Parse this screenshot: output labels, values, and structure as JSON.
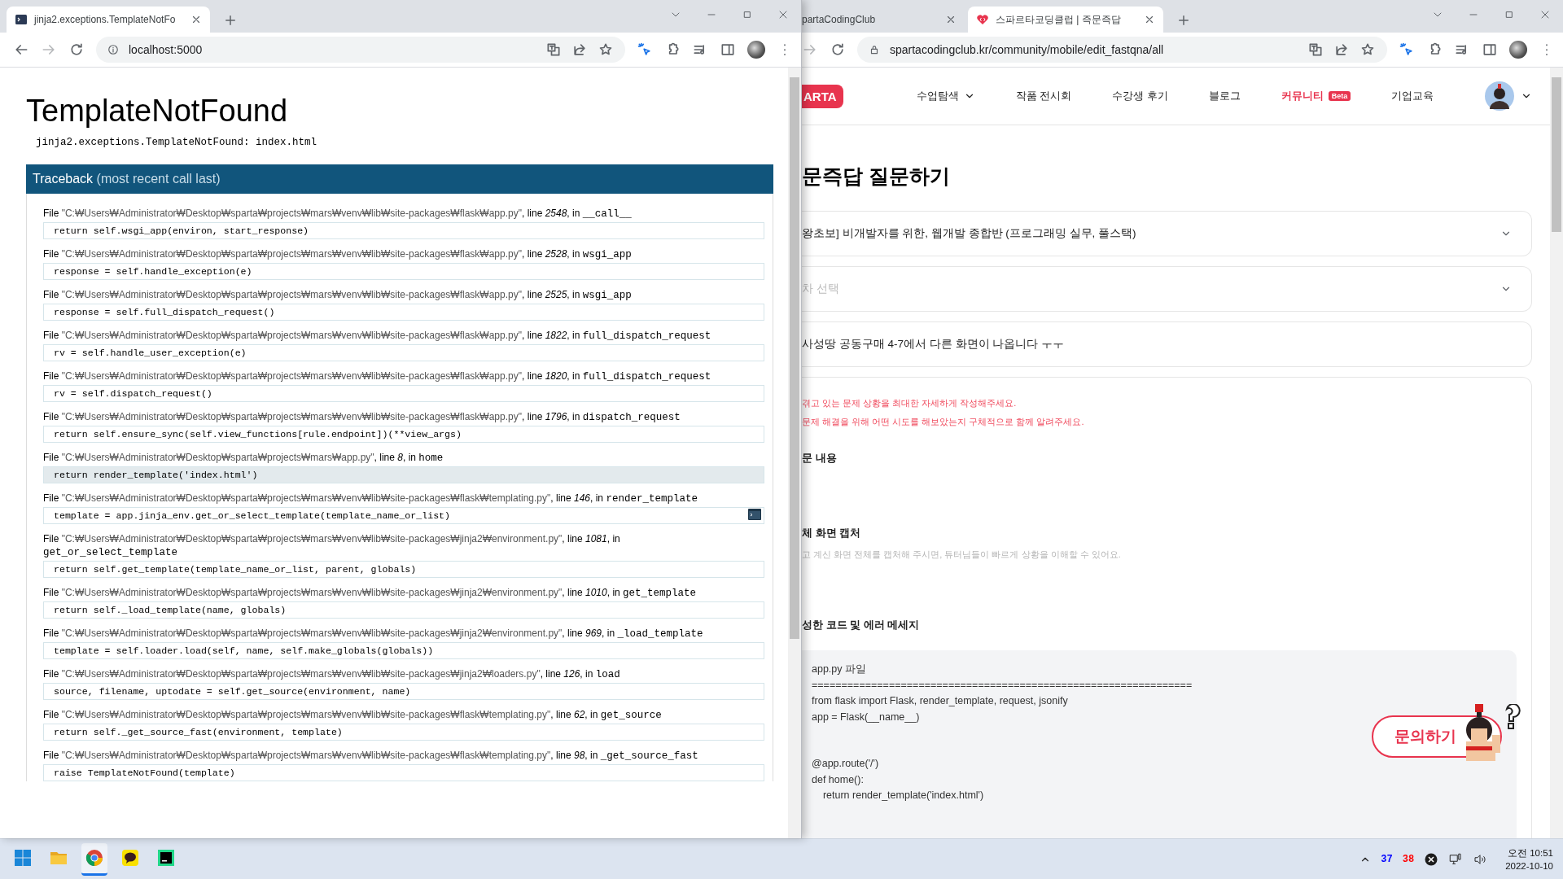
{
  "left_browser": {
    "tabs": [
      {
        "title": "jinja2.exceptions.TemplateNotFo",
        "selected": true
      }
    ],
    "address": "localhost:5000",
    "page": {
      "title": "TemplateNotFound",
      "exception": "jinja2.exceptions.TemplateNotFound: index.html",
      "traceback_title": "Traceback",
      "traceback_note": "(most recent call last)",
      "frames": [
        {
          "lead": "File",
          "path": "\"C:₩Users₩Administrator₩Desktop₩sparta₩projects₩mars₩venv₩lib₩site-packages₩flask₩app.py\"",
          "mid": ", line",
          "line": "2548",
          "tail": ", in",
          "function": "__call__",
          "code": "return self.wsgi_app(environ, start_response)",
          "highlighted": false,
          "console": false
        },
        {
          "lead": "File",
          "path": "\"C:₩Users₩Administrator₩Desktop₩sparta₩projects₩mars₩venv₩lib₩site-packages₩flask₩app.py\"",
          "mid": ", line",
          "line": "2528",
          "tail": ", in",
          "function": "wsgi_app",
          "code": "response = self.handle_exception(e)",
          "highlighted": false,
          "console": false
        },
        {
          "lead": "File",
          "path": "\"C:₩Users₩Administrator₩Desktop₩sparta₩projects₩mars₩venv₩lib₩site-packages₩flask₩app.py\"",
          "mid": ", line",
          "line": "2525",
          "tail": ", in",
          "function": "wsgi_app",
          "code": "response = self.full_dispatch_request()",
          "highlighted": false,
          "console": false
        },
        {
          "lead": "File",
          "path": "\"C:₩Users₩Administrator₩Desktop₩sparta₩projects₩mars₩venv₩lib₩site-packages₩flask₩app.py\"",
          "mid": ", line",
          "line": "1822",
          "tail": ", in",
          "function": "full_dispatch_request",
          "code": "rv = self.handle_user_exception(e)",
          "highlighted": false,
          "console": false
        },
        {
          "lead": "File",
          "path": "\"C:₩Users₩Administrator₩Desktop₩sparta₩projects₩mars₩venv₩lib₩site-packages₩flask₩app.py\"",
          "mid": ", line",
          "line": "1820",
          "tail": ", in",
          "function": "full_dispatch_request",
          "code": "rv = self.dispatch_request()",
          "highlighted": false,
          "console": false
        },
        {
          "lead": "File",
          "path": "\"C:₩Users₩Administrator₩Desktop₩sparta₩projects₩mars₩venv₩lib₩site-packages₩flask₩app.py\"",
          "mid": ", line",
          "line": "1796",
          "tail": ", in",
          "function": "dispatch_request",
          "code": "return self.ensure_sync(self.view_functions[rule.endpoint])(**view_args)",
          "highlighted": false,
          "console": false
        },
        {
          "lead": "File",
          "path": "\"C:₩Users₩Administrator₩Desktop₩sparta₩projects₩mars₩app.py\"",
          "mid": ", line",
          "line": "8",
          "tail": ", in",
          "function": "home",
          "code": "return render_template('index.html')",
          "highlighted": true,
          "console": false
        },
        {
          "lead": "File",
          "path": "\"C:₩Users₩Administrator₩Desktop₩sparta₩projects₩mars₩venv₩lib₩site-packages₩flask₩templating.py\"",
          "mid": ", line",
          "line": "146",
          "tail": ", in",
          "function": "render_template",
          "code": "template = app.jinja_env.get_or_select_template(template_name_or_list)",
          "highlighted": false,
          "console": true
        },
        {
          "lead": "File",
          "path": "\"C:₩Users₩Administrator₩Desktop₩sparta₩projects₩mars₩venv₩lib₩site-packages₩jinja2₩environment.py\"",
          "mid": ", line",
          "line": "1081",
          "tail": ", in",
          "function": "get_or_select_template",
          "code": "return self.get_template(template_name_or_list, parent, globals)",
          "highlighted": false,
          "console": false
        },
        {
          "lead": "File",
          "path": "\"C:₩Users₩Administrator₩Desktop₩sparta₩projects₩mars₩venv₩lib₩site-packages₩jinja2₩environment.py\"",
          "mid": ", line",
          "line": "1010",
          "tail": ", in",
          "function": "get_template",
          "code": "return self._load_template(name, globals)",
          "highlighted": false,
          "console": false
        },
        {
          "lead": "File",
          "path": "\"C:₩Users₩Administrator₩Desktop₩sparta₩projects₩mars₩venv₩lib₩site-packages₩jinja2₩environment.py\"",
          "mid": ", line",
          "line": "969",
          "tail": ", in",
          "function": "_load_template",
          "code": "template = self.loader.load(self, name, self.make_globals(globals))",
          "highlighted": false,
          "console": false
        },
        {
          "lead": "File",
          "path": "\"C:₩Users₩Administrator₩Desktop₩sparta₩projects₩mars₩venv₩lib₩site-packages₩jinja2₩loaders.py\"",
          "mid": ", line",
          "line": "126",
          "tail": ", in",
          "function": "load",
          "code": "source, filename, uptodate = self.get_source(environment, name)",
          "highlighted": false,
          "console": false
        },
        {
          "lead": "File",
          "path": "\"C:₩Users₩Administrator₩Desktop₩sparta₩projects₩mars₩venv₩lib₩site-packages₩flask₩templating.py\"",
          "mid": ", line",
          "line": "62",
          "tail": ", in",
          "function": "get_source",
          "code": "return self._get_source_fast(environment, template)",
          "highlighted": false,
          "console": false
        },
        {
          "lead": "File",
          "path": "\"C:₩Users₩Administrator₩Desktop₩sparta₩projects₩mars₩venv₩lib₩site-packages₩flask₩templating.py\"",
          "mid": ", line",
          "line": "98",
          "tail": ", in",
          "function": "_get_source_fast",
          "code": "raise TemplateNotFound(template)",
          "highlighted": false,
          "console": false
        }
      ]
    }
  },
  "right_browser": {
    "tabs": [
      {
        "title": "partaCodingClub",
        "selected": false
      },
      {
        "title": "스파르타코딩클럽 | 즉문즉답",
        "selected": true
      }
    ],
    "address": "spartacodingclub.kr/community/mobile/edit_fastqna/all",
    "nav": {
      "logo": "ARTA",
      "items": [
        {
          "label": "수업탐색",
          "kind": "dropdown",
          "selected": false
        },
        {
          "label": "작품 전시회",
          "kind": "link",
          "selected": false
        },
        {
          "label": "수강생 후기",
          "kind": "link",
          "selected": false
        },
        {
          "label": "블로그",
          "kind": "link",
          "selected": false
        },
        {
          "label": "커뮤니티",
          "kind": "link",
          "selected": true,
          "badge": "Beta"
        },
        {
          "label": "기업교육",
          "kind": "link",
          "selected": false
        }
      ]
    },
    "title": "문즉답 질문하기",
    "fields": [
      {
        "kind": "select",
        "value": "왕초보] 비개발자를 위한, 웹개발 종합반 (프로그래밍 실무, 풀스택)"
      },
      {
        "kind": "select",
        "placeholder": "차 선택"
      },
      {
        "kind": "input",
        "value": "사성땅 공동구매 4-7에서 다른 화면이 나옵니다 ㅜㅜ"
      }
    ],
    "editor": {
      "hints": [
        "겪고 있는 문제 상황을 최대한 자세하게 작성해주세요.",
        "문제 해결을 위해 어떤 시도를 해보았는지 구체적으로 함께 알려주세요."
      ],
      "sections": [
        {
          "heading": "문 내용"
        },
        {
          "heading": "체 화면 캡처",
          "hint": "고 계신 화면 전체를 캡처해 주시면, 튜터님들이 빠르게 상황을 이해할 수 있어요."
        },
        {
          "heading": "성한 코드 및 에러 메세지"
        }
      ],
      "code_blocks": [
        [
          "app.py 파일",
          "================================================================",
          "from flask import Flask, render_template, request, jsonify",
          "app = Flask(__name__)"
        ],
        [
          "@app.route('/')",
          "def home():",
          "    return render_template('index.html')"
        ]
      ]
    },
    "ask_button": "문의하기"
  },
  "taskbar": {
    "apps": [
      {
        "kind": "start",
        "selected": false
      },
      {
        "kind": "folder",
        "selected": false
      },
      {
        "kind": "chrome",
        "selected": true
      },
      {
        "kind": "chat",
        "selected": false
      },
      {
        "kind": "pycharm",
        "selected": false
      }
    ],
    "counters": [
      {
        "text": "37",
        "color": "#0000ff"
      },
      {
        "text": "38",
        "color": "#ff0000"
      }
    ],
    "time": "오전 10:51",
    "date": "2022-10-10"
  }
}
